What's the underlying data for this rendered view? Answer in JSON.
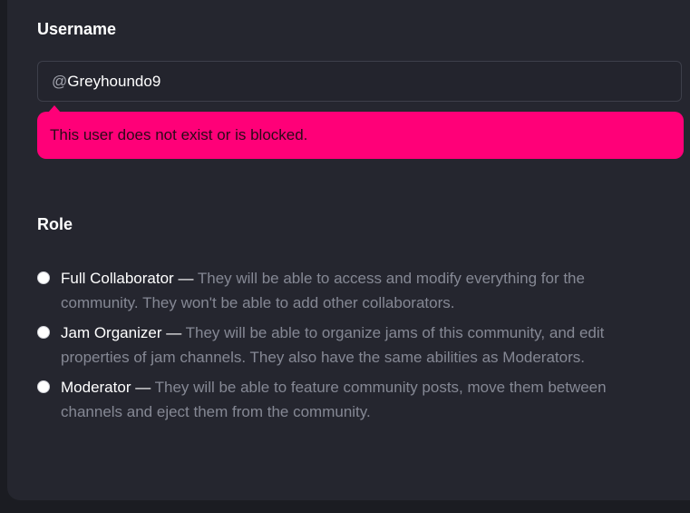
{
  "username": {
    "label": "Username",
    "prefix": "@",
    "value": "Greyhoundo9",
    "error": "This user does not exist or is blocked."
  },
  "role": {
    "label": "Role",
    "options": [
      {
        "name": "Full Collaborator —",
        "description": "They will be able to access and modify everything for the community. They won't be able to add other collaborators."
      },
      {
        "name": "Jam Organizer —",
        "description": "They will be able to organize jams of this community, and edit properties of jam channels. They also have the same abilities as Moderators."
      },
      {
        "name": "Moderator —",
        "description": "They will be able to feature community posts, move them between channels and eject them from the community."
      }
    ]
  },
  "colors": {
    "error_background": "#ff0078",
    "panel_background": "#25262f"
  }
}
